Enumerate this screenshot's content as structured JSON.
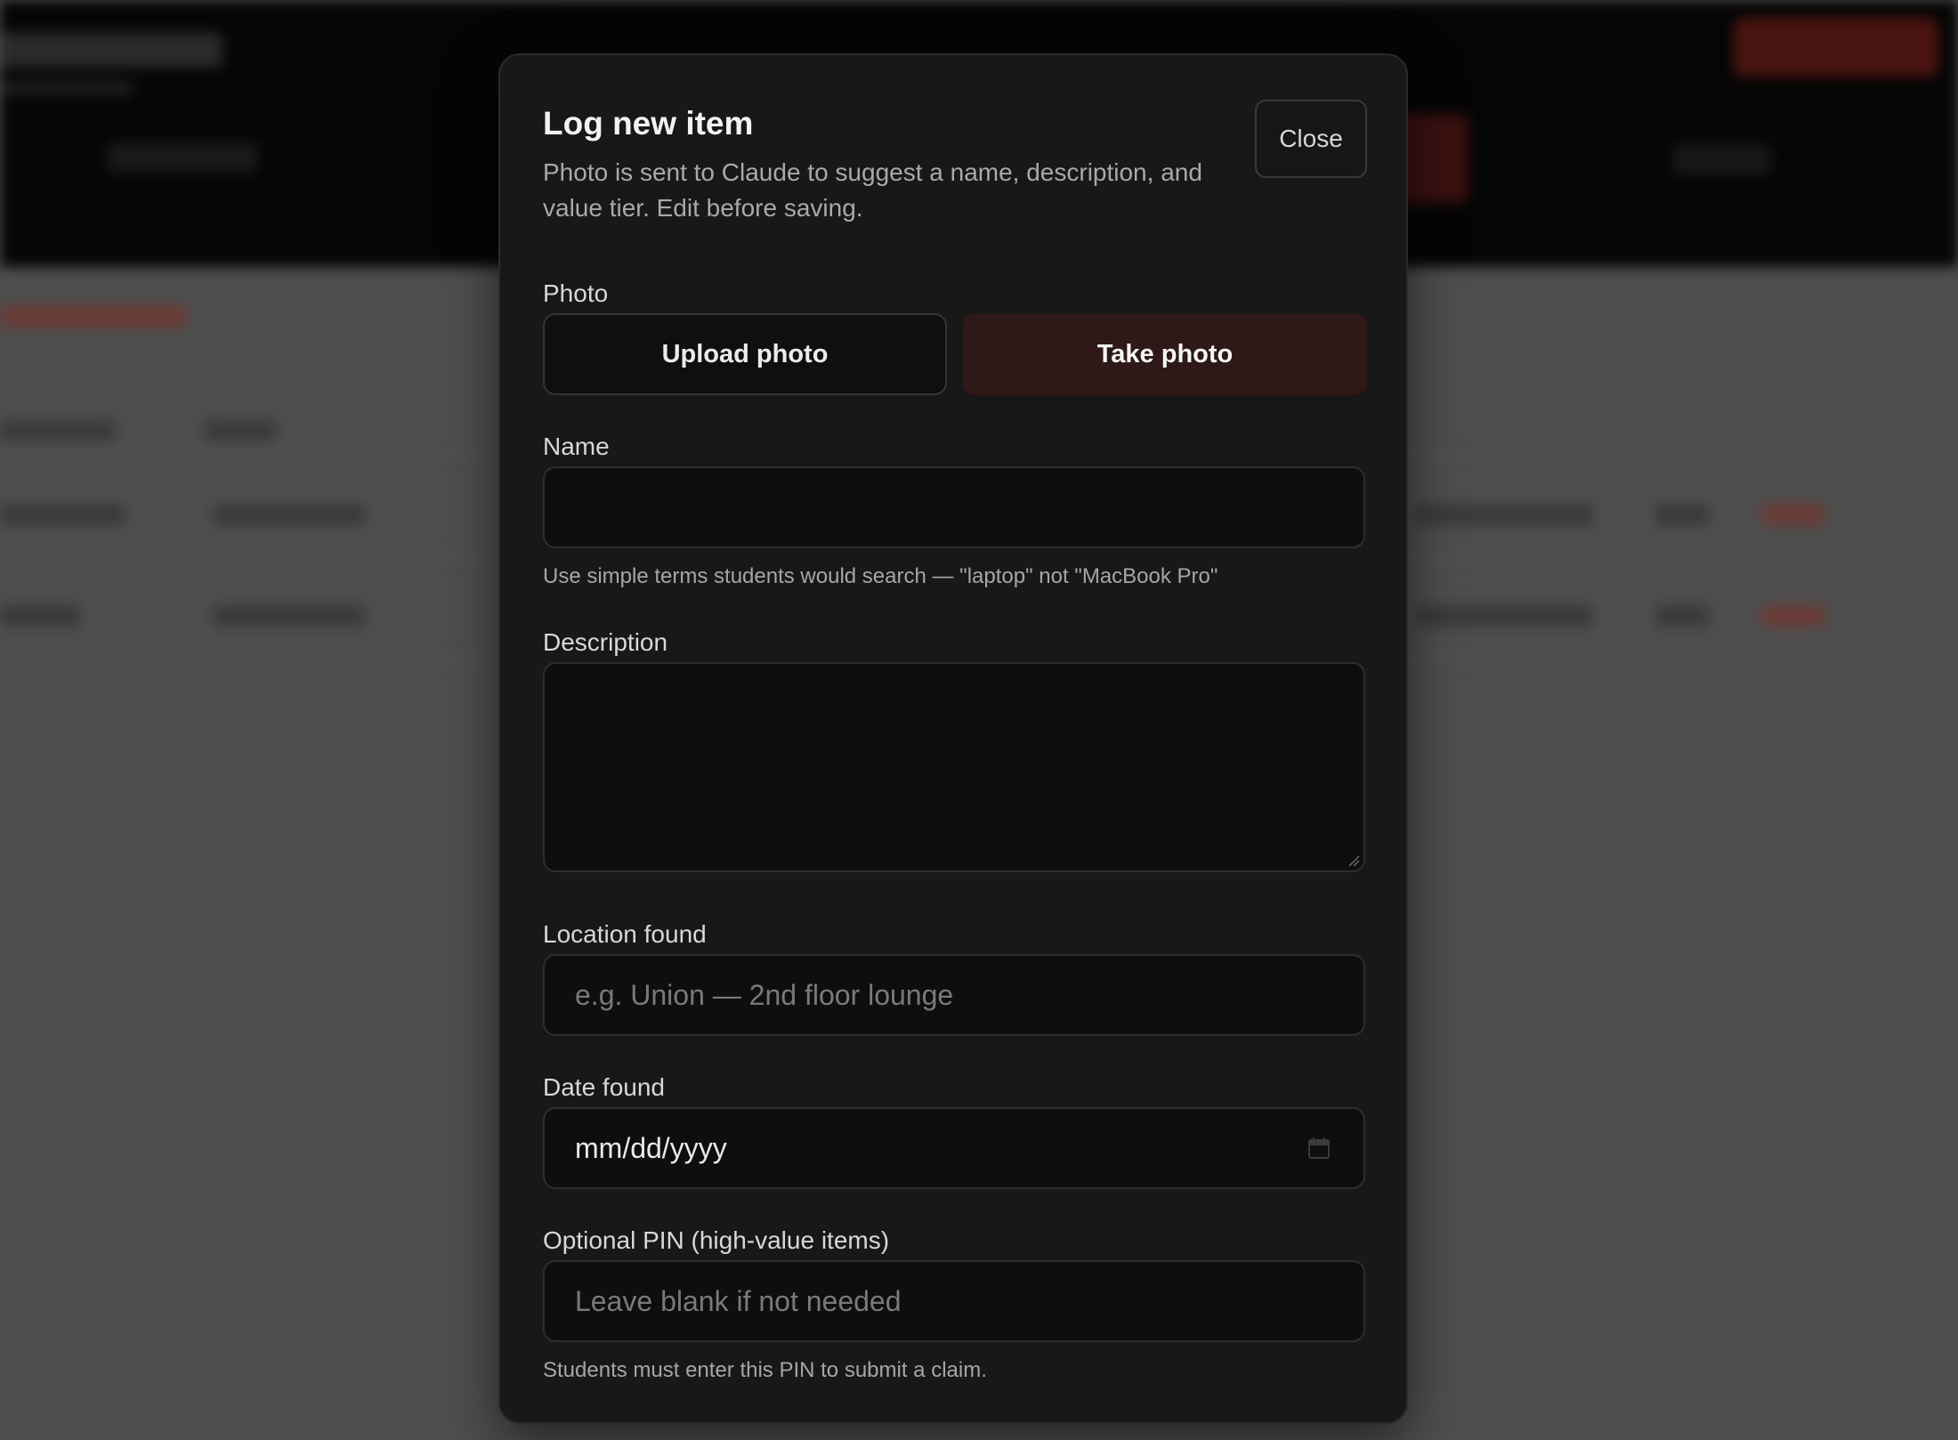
{
  "modal": {
    "title": "Log new item",
    "subtitle": "Photo is sent to Claude to suggest a name, description, and value tier. Edit before saving.",
    "close_label": "Close"
  },
  "photo": {
    "label": "Photo",
    "upload_label": "Upload photo",
    "take_label": "Take photo"
  },
  "name": {
    "label": "Name",
    "value": "",
    "hint": "Use simple terms students would search — \"laptop\" not \"MacBook Pro\""
  },
  "description": {
    "label": "Description",
    "value": ""
  },
  "location": {
    "label": "Location found",
    "placeholder": "e.g. Union — 2nd floor lounge"
  },
  "date": {
    "label": "Date found",
    "display": "mm/dd/yyyy",
    "icon": "calendar-icon"
  },
  "pin": {
    "label": "Optional PIN (high-value items)",
    "placeholder": "Leave blank if not needed",
    "hint": "Students must enter this PIN to submit a claim."
  },
  "colors": {
    "modal_bg": "#181818",
    "input_bg": "#0e0e0e",
    "accent_dark_red": "#2e1918",
    "overlay": "#4e4e4e"
  }
}
